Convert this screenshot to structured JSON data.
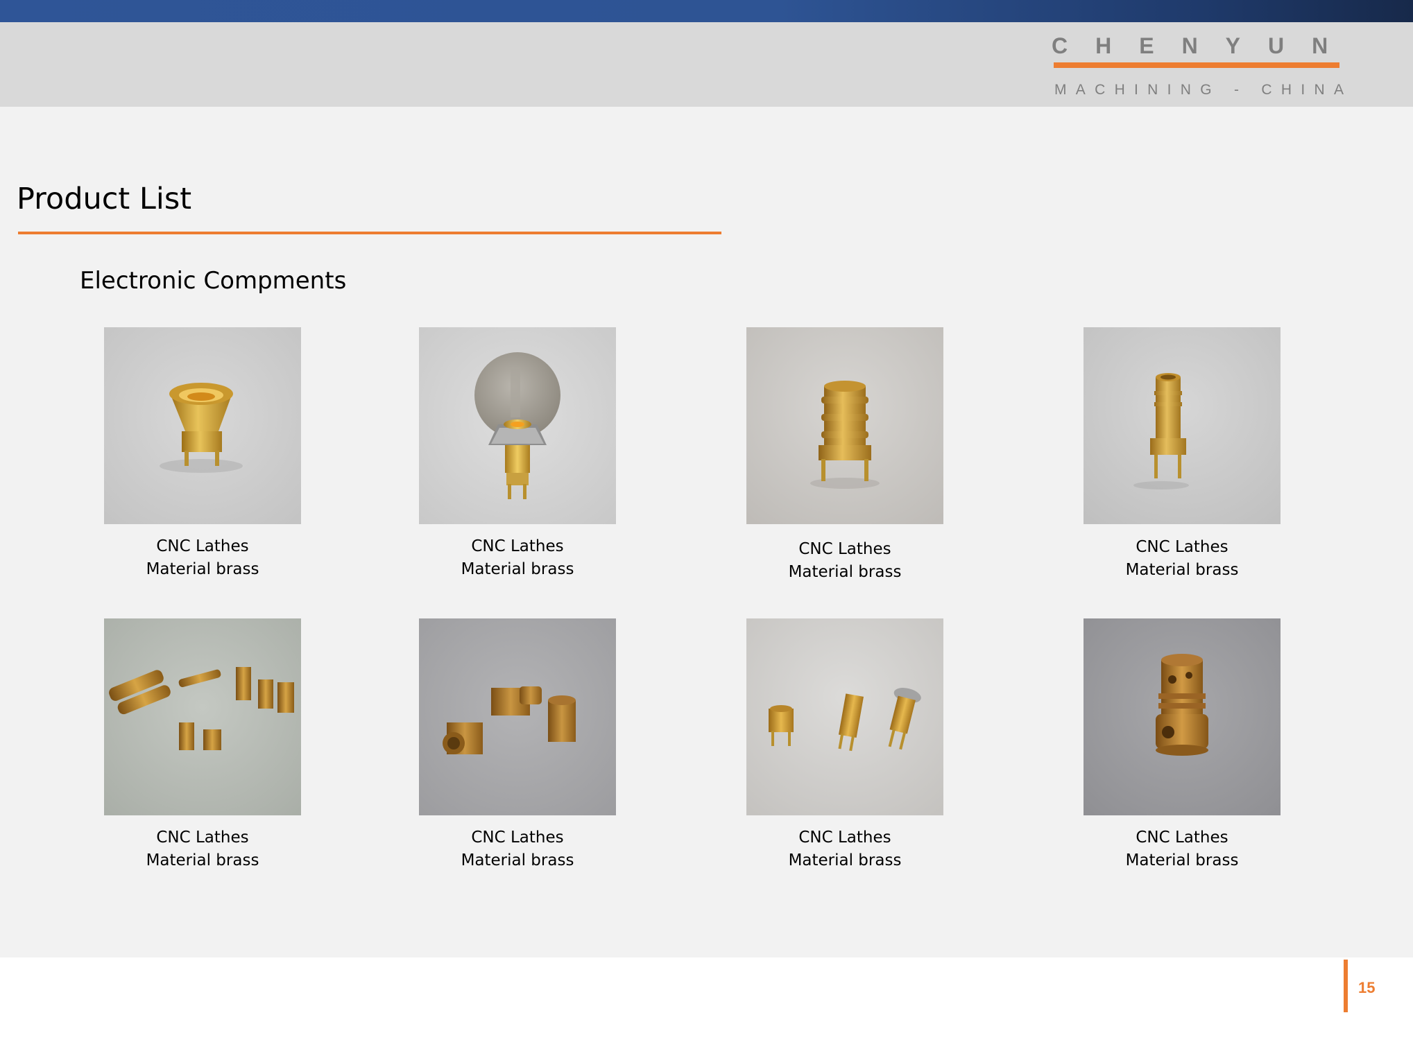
{
  "brand": {
    "name": "CHENYUN",
    "tagline": "MACHINING - CHINA"
  },
  "page": {
    "title": "Product List",
    "section": "Electronic Compments",
    "number": "15"
  },
  "products": [
    {
      "line1": "CNC Lathes",
      "line2": "Material brass",
      "icon": "brass-funnel-connector-photo"
    },
    {
      "line1": "CNC Lathes",
      "line2": "Material brass",
      "icon": "brass-connector-with-coin-photo"
    },
    {
      "line1": "CNC Lathes",
      "line2": "Material brass",
      "icon": "brass-ribbed-connector-photo"
    },
    {
      "line1": "CNC Lathes",
      "line2": "Material brass",
      "icon": "brass-tall-connector-photo"
    },
    {
      "line1": "CNC Lathes",
      "line2": "Material brass",
      "icon": "brass-parts-group-photo"
    },
    {
      "line1": "CNC Lathes",
      "line2": "Material brass",
      "icon": "brass-pcb-connectors-photo"
    },
    {
      "line1": "CNC Lathes",
      "line2": "Material brass",
      "icon": "brass-three-connectors-photo"
    },
    {
      "line1": "CNC Lathes",
      "line2": "Material brass",
      "icon": "brass-grooved-fitting-photo"
    }
  ],
  "colors": {
    "accent": "#ed7d31",
    "topbar": "#2f5597",
    "header": "#d9d9d9",
    "content": "#f2f2f2",
    "brand_text": "#7f7f7f"
  }
}
